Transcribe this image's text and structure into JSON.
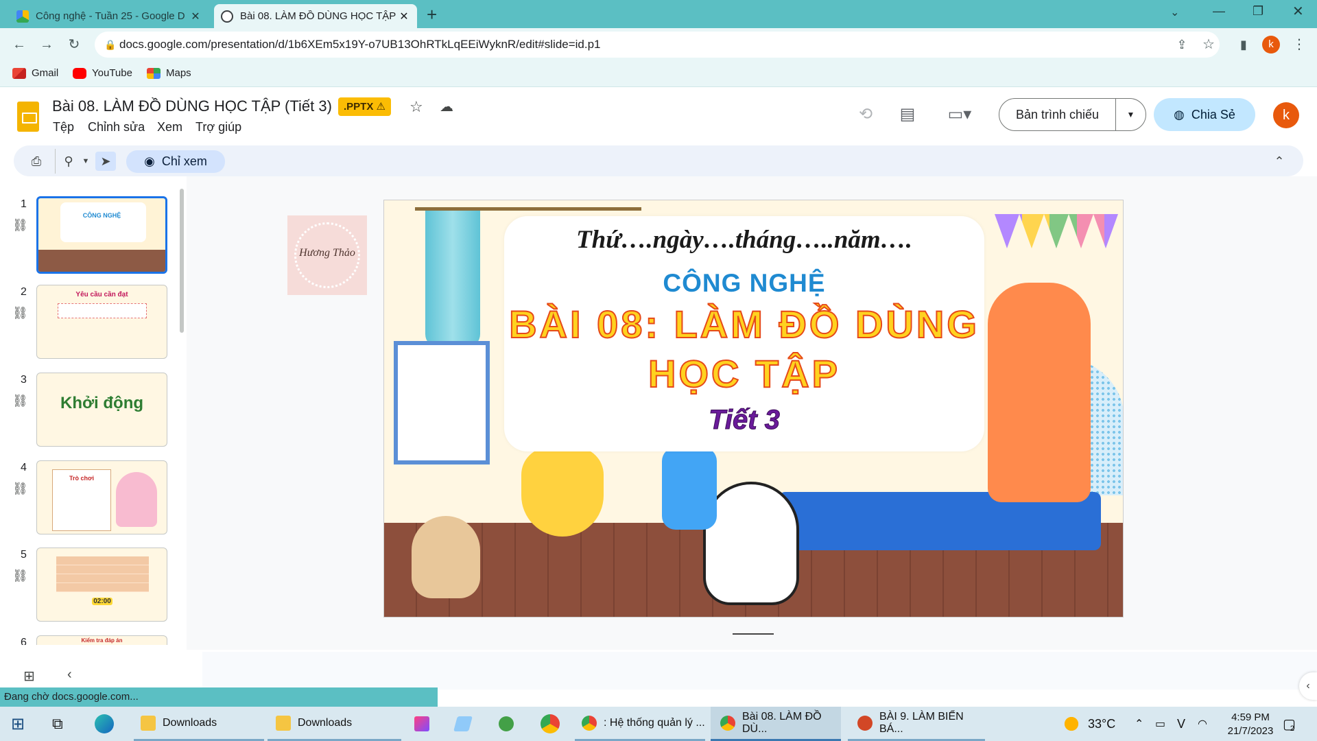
{
  "browser": {
    "tabs": [
      {
        "title": "Công nghệ - Tuần 25 - Google D",
        "close": "✕"
      },
      {
        "title": "Bài 08. LÀM ĐỒ DÙNG HỌC TẬP",
        "close": "✕"
      }
    ],
    "new_tab": "+",
    "url": "docs.google.com/presentation/d/1b6XEm5x19Y-o7UB13OhRTkLqEEiWyknR/edit#slide=id.p1",
    "profile_initial": "k",
    "bookmarks": [
      {
        "label": "Gmail"
      },
      {
        "label": "YouTube"
      },
      {
        "label": "Maps"
      }
    ]
  },
  "doc": {
    "title": "Bài 08. LÀM ĐỒ DÙNG HỌC TẬP (Tiết 3)",
    "badge": ".PPTX ⚠",
    "menu": [
      "Tệp",
      "Chỉnh sửa",
      "Xem",
      "Trợ giúp"
    ],
    "slideshow_label": "Bản trình chiếu",
    "share_label": "Chia Sẻ",
    "account_initial": "k",
    "view_mode_label": "Chỉ xem"
  },
  "filmstrip": {
    "slides": [
      {
        "num": "1",
        "text": "CÔNG NGHỆ"
      },
      {
        "num": "2",
        "text": "Yêu cầu cần đạt"
      },
      {
        "num": "3",
        "text": "Khởi động"
      },
      {
        "num": "4",
        "text": "Trò chơi"
      },
      {
        "num": "5",
        "text": "02:00"
      },
      {
        "num": "6",
        "text": "Kiểm tra đáp án"
      }
    ]
  },
  "watermark": {
    "name": "Hương Thảo"
  },
  "slide": {
    "date_line": "Thứ….ngày….tháng…..năm….",
    "subject": "CÔNG NGHỆ",
    "title_line1": "BÀI 08: LÀM ĐỒ DÙNG",
    "title_line2": "HỌC TẬP",
    "period": "Tiết 3"
  },
  "status_text": "Đang chờ docs.google.com...",
  "taskbar": {
    "items": [
      {
        "label": "Downloads"
      },
      {
        "label": "Downloads"
      },
      {
        "label": ": Hệ thống quản lý ..."
      },
      {
        "label": "Bài 08. LÀM ĐỒ DÙ..."
      },
      {
        "label": "BÀI 9. LÀM BIỂN BÁ..."
      }
    ],
    "weather": "33°C",
    "time": "4:59 PM",
    "date": "21/7/2023",
    "notifications": "2"
  },
  "colors": {
    "chrome_frame": "#5bbfc3",
    "share_button": "#c2e7ff",
    "slide_title_fill": "#ffd21f",
    "slide_subject": "#1f8ad1"
  }
}
